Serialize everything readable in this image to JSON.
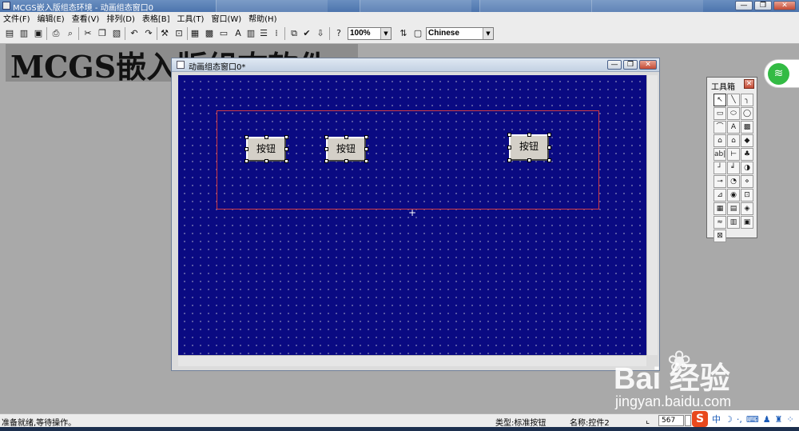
{
  "app": {
    "title": "MCGS嵌入版组态环境 - 动画组态窗口0",
    "window_controls": {
      "minimize": "—",
      "restore": "❐",
      "close": "✕"
    }
  },
  "menu": [
    "文件(F)",
    "编辑(E)",
    "查看(V)",
    "排列(D)",
    "表格[B]",
    "工具(T)",
    "窗口(W)",
    "帮助(H)"
  ],
  "toolbar": {
    "zoom_value": "100%",
    "language_value": "Chinese"
  },
  "background_title": "MCGS嵌入版组态软件",
  "design_window": {
    "title": "动画组态窗口0*",
    "buttons": [
      {
        "label": "按钮"
      },
      {
        "label": "按钮"
      },
      {
        "label": "按钮"
      }
    ]
  },
  "toolbox": {
    "title": "工具箱",
    "tools": [
      "↖",
      "╲",
      "╮",
      "▭",
      "⬭",
      "◯",
      "⌒",
      "A",
      "▩",
      "⌂",
      "⌂",
      "◆",
      "ab|",
      "⊢",
      "♣",
      "┘",
      "╛",
      "◑",
      "⊸",
      "◔",
      "⋄",
      "⊿",
      "◉",
      "⊡",
      "▦",
      "▤",
      "◈",
      "≈",
      "▥",
      "▣",
      "⊠"
    ]
  },
  "status": {
    "message": "准备就绪,等待操作。",
    "type": "类型:标准按钮",
    "name": "名称:控件2",
    "coord_x": "567"
  },
  "watermark": {
    "brand": "Bai  经验",
    "url": "jingyan.baidu.com"
  },
  "ime": {
    "logo": "S",
    "mode": "中"
  },
  "colors": {
    "canvas": "#0a0a82",
    "selection": "#d03a44",
    "titlebar": "#4c74ad"
  }
}
